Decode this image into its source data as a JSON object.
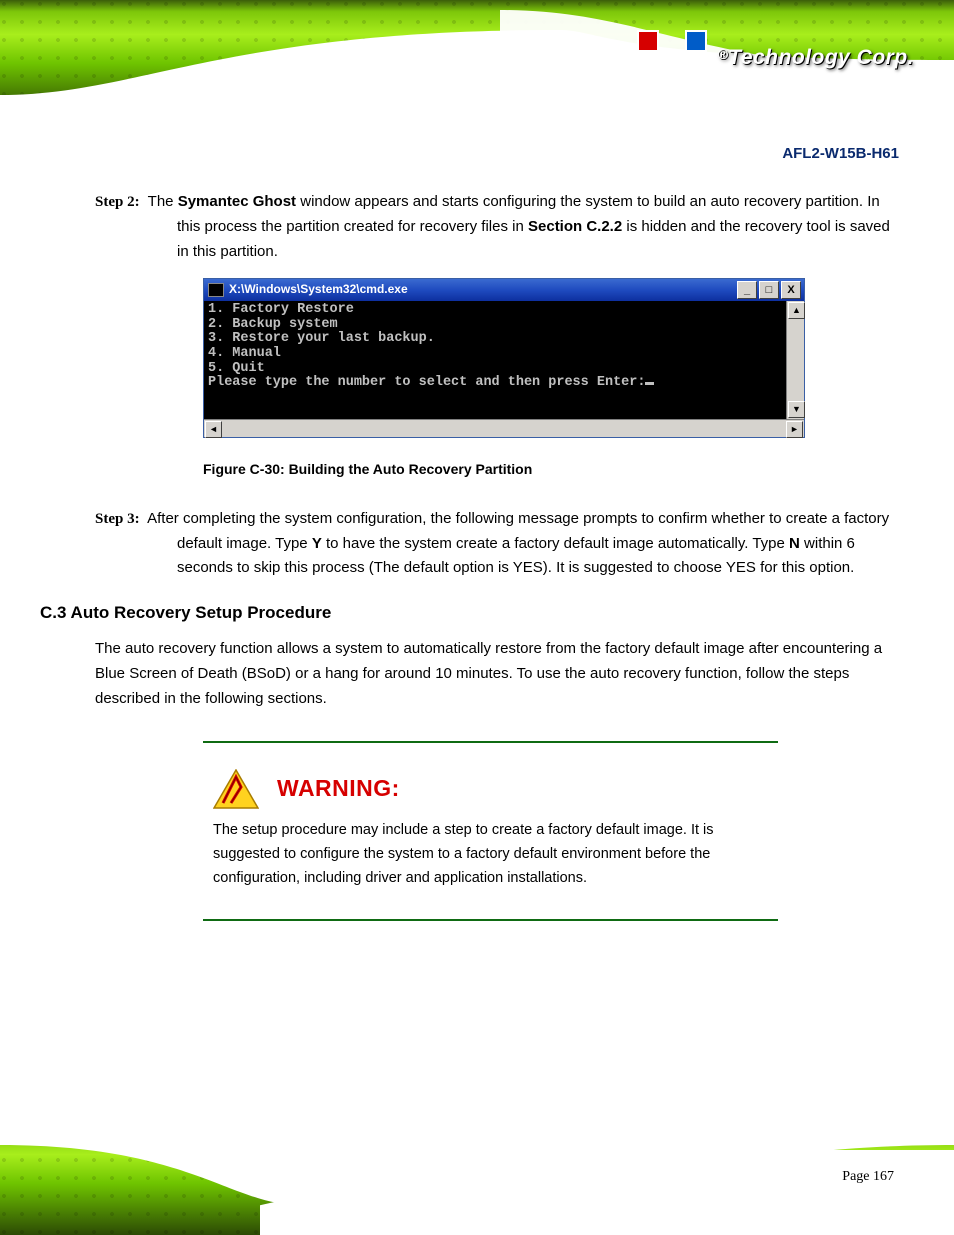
{
  "brand": {
    "reg": "®",
    "name": "Technology Corp."
  },
  "header": {
    "product_title": "AFL2-W15B-H61"
  },
  "body": {
    "step2_label": "Step 2:",
    "step2_text_a": "The ",
    "step2_bold": "Symantec Ghost",
    "step2_text_b": " window appears and starts configuring the system to build an auto recovery partition. In this process the partition created for recovery files in ",
    "step2_section_ref": "Section C.2.2",
    "step2_text_c": " is hidden and the recovery tool is saved in this partition.",
    "fig_label": "Figure C-30: Building the Auto Recovery Partition",
    "step3_label": "Step 3:",
    "step3_text_a": "After completing the system configuration, the following message prompts to confirm whether to create a factory default image. Type ",
    "step3_bold1": "Y",
    "step3_text_b": " to have the system create a factory default image automatically. Type ",
    "step3_bold2": "N",
    "step3_text_c": " within 6 seconds to skip this process (The default option is YES). It is suggested to choose YES for this option.",
    "section_head": "C.3 Auto Recovery Setup Procedure",
    "section_para": "The auto recovery function allows a system to automatically restore from the factory default image after encountering a Blue Screen of Death (BSoD) or a hang for around 10 minutes. To use the auto recovery function, follow the steps described in the following sections."
  },
  "cmd": {
    "title": "X:\\Windows\\System32\\cmd.exe",
    "lines": [
      "1. Factory Restore",
      "2. Backup system",
      "3. Restore your last backup.",
      "4. Manual",
      "5. Quit",
      "Please type the number to select and then press Enter:"
    ],
    "btn_min": "_",
    "btn_max": "□",
    "btn_close": "X",
    "arrow_up": "▲",
    "arrow_down": "▼",
    "arrow_left": "◄",
    "arrow_right": "►"
  },
  "warning": {
    "title": "WARNING:",
    "text_a": "The setup procedure may include a step to create a factory default image. It is suggested to configure the system to a factory default environment before the configuration, including driver and application installations."
  },
  "footer": {
    "page_label": "Page 167"
  }
}
